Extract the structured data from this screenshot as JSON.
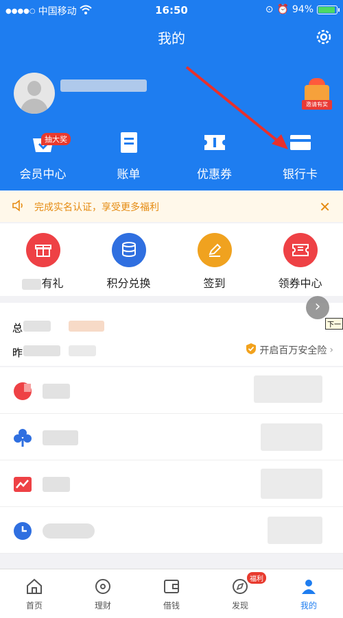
{
  "status_bar": {
    "carrier": "中国移动",
    "time": "16:50",
    "battery": "94%"
  },
  "header": {
    "title": "我的",
    "gift_label": "邀请有奖"
  },
  "top_actions": [
    {
      "label": "会员中心",
      "badge": "抽大奖"
    },
    {
      "label": "账单"
    },
    {
      "label": "优惠券"
    },
    {
      "label": "银行卡"
    }
  ],
  "notice": {
    "text": "完成实名认证，享受更多福利"
  },
  "quick_actions": [
    {
      "label": "有礼",
      "color": "#ee4145"
    },
    {
      "label": "积分兑换",
      "color": "#2f6fe0"
    },
    {
      "label": "签到",
      "color": "#f0a21f"
    },
    {
      "label": "领券中心",
      "color": "#ee4145"
    }
  ],
  "assets": {
    "row1_prefix": "总",
    "row2_prefix": "昨",
    "insurance_link": "开启百万安全险",
    "next_tip": "下一"
  },
  "tabbar": [
    {
      "label": "首页",
      "badge": ""
    },
    {
      "label": "理财",
      "badge": ""
    },
    {
      "label": "借钱",
      "badge": ""
    },
    {
      "label": "发现",
      "badge": "福利"
    },
    {
      "label": "我的",
      "badge": ""
    }
  ],
  "colors": {
    "primary": "#1e7df0",
    "notice": "#e58b12",
    "red": "#ee4145"
  }
}
